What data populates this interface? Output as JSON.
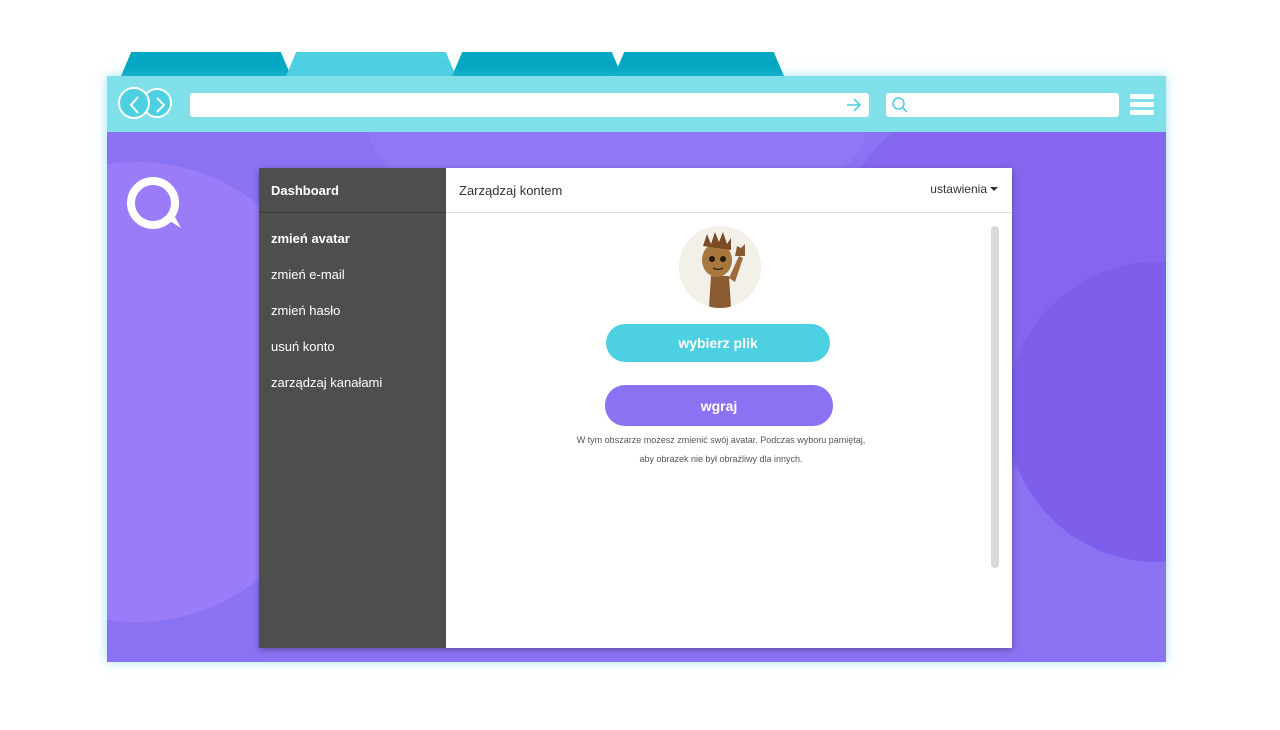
{
  "browser": {
    "tabs": [
      "",
      "",
      "",
      ""
    ],
    "url_value": "",
    "search_value": ""
  },
  "dashboard": {
    "sidebar_title": "Dashboard",
    "menu": [
      {
        "label": "zmień avatar"
      },
      {
        "label": "zmień e-mail"
      },
      {
        "label": "zmień hasło"
      },
      {
        "label": "usuń konto"
      },
      {
        "label": "zarządzaj kanałami"
      }
    ],
    "header_title": "Zarządzaj kontem",
    "settings_label": "ustawienia",
    "choose_file_label": "wybierz plik",
    "upload_label": "wgraj",
    "info_line1": "W tym obszarze możesz zmienić swój avatar. Podczas wyboru pamiętaj,",
    "info_line2": "aby obrazek nie był obraźliwy dla innych."
  },
  "colors": {
    "accent_cyan": "#4dd0e1",
    "accent_purple": "#8b72f2",
    "sidebar_bg": "#4e4e4e",
    "tab_dark": "#05a8c2"
  },
  "icons": [
    "back-icon",
    "forward-icon",
    "go-arrow-icon",
    "search-icon",
    "menu-icon",
    "chat-logo-icon",
    "caret-down-icon"
  ]
}
